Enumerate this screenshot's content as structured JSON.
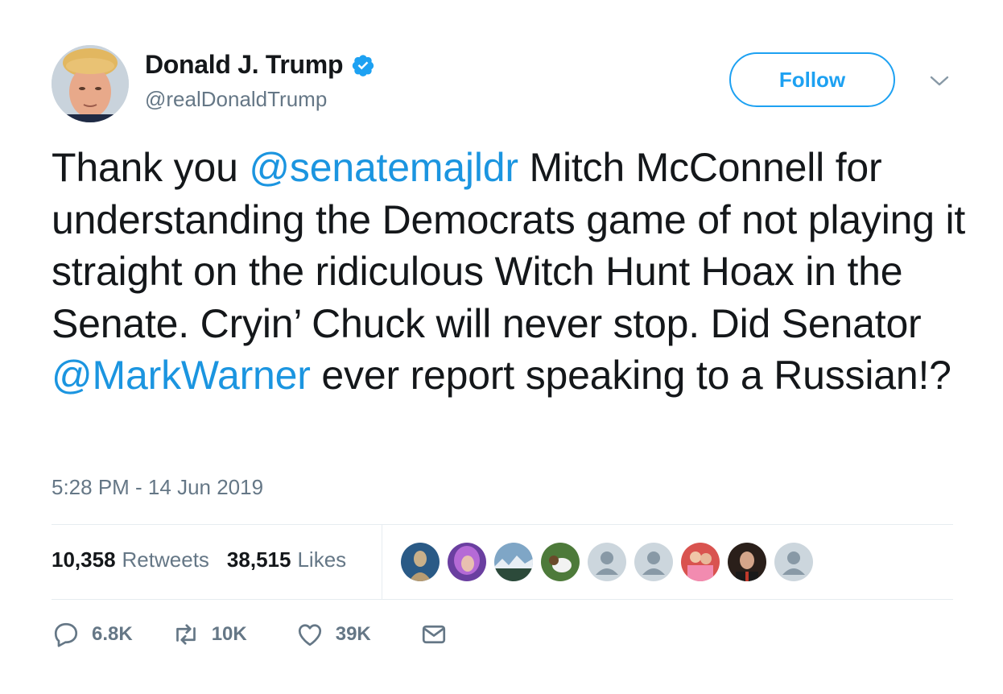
{
  "author": {
    "name": "Donald J. Trump",
    "handle": "@realDonaldTrump",
    "verified": true
  },
  "follow_button": {
    "label": "Follow"
  },
  "tweet": {
    "segments": [
      {
        "text": "Thank you ",
        "type": "text"
      },
      {
        "text": "@senatemajldr",
        "type": "mention"
      },
      {
        "text": " Mitch McConnell for understanding the Democrats game of not playing it straight on the ridiculous Witch Hunt Hoax in the Senate. Cryin’ Chuck will never stop. Did Senator ",
        "type": "text"
      },
      {
        "text": "@MarkWarner",
        "type": "mention"
      },
      {
        "text": " ever report speaking to a Russian!?",
        "type": "text"
      }
    ],
    "timestamp": "5:28 PM - 14 Jun 2019"
  },
  "stats": {
    "retweets_count": "10,358",
    "retweets_label": "Retweets",
    "likes_count": "38,515",
    "likes_label": "Likes"
  },
  "likers": [
    "statue",
    "purple-hair",
    "mountains",
    "dog",
    "default",
    "default",
    "couple",
    "man",
    "default"
  ],
  "actions": {
    "replies": "6.8K",
    "retweets": "10K",
    "likes": "39K"
  },
  "colors": {
    "accent": "#1da1f2",
    "mention": "#1b95e0",
    "secondary_text": "#657786",
    "divider": "#e6ecf0"
  }
}
